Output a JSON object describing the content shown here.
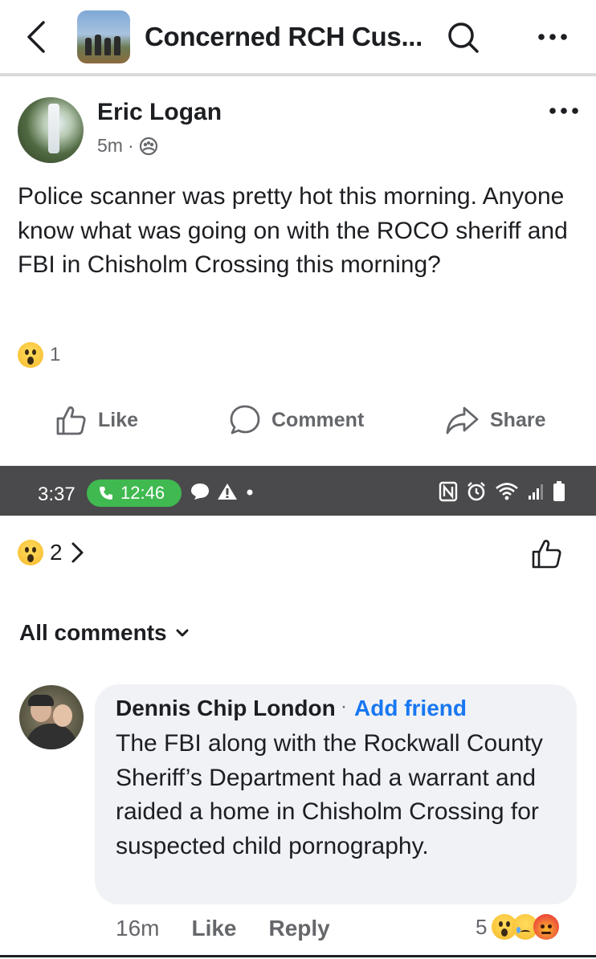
{
  "header": {
    "group_title": "Concerned RCH Cus...",
    "icons": [
      "back-chevron-icon",
      "search-icon",
      "more-options-icon"
    ]
  },
  "post": {
    "author": "Eric Logan",
    "time": "5m",
    "separator": "·",
    "audience_icon": "group-members-icon",
    "text": "Police scanner was pretty hot this morning. Anyone know what was going on with the ROCO sheriff and FBI in Chisholm Crossing this morning?",
    "reaction_count": "1",
    "actions": {
      "like": "Like",
      "comment": "Comment",
      "share": "Share"
    }
  },
  "status_bar": {
    "time": "3:37",
    "call_duration": "12:46",
    "icons": [
      "chat-bubble-icon",
      "warning-icon",
      "dot-icon",
      "nfc-icon",
      "alarm-icon",
      "wifi-icon",
      "signal-icon",
      "battery-icon"
    ],
    "colors": {
      "background": "#4a4a4c",
      "call_pill": "#3fb950"
    }
  },
  "reactions_summary": {
    "count": "2",
    "chevron": "›"
  },
  "comments": {
    "filter_label": "All comments",
    "items": [
      {
        "name": "Dennis Chip London",
        "separator": "·",
        "add_friend": "Add friend",
        "text": "The FBI along with the Rockwall County Sheriff’s Department had a warrant and raided a home in Chisholm Crossing for suspected child pornography.",
        "time": "16m",
        "like": "Like",
        "reply": "Reply",
        "reaction_count": "5",
        "reactions": [
          "wow",
          "sad",
          "angry"
        ]
      }
    ]
  },
  "colors": {
    "accent": "#1877f2",
    "text": "#1c1e21",
    "secondary_text": "#65676b",
    "bubble": "#f0f2f5"
  }
}
